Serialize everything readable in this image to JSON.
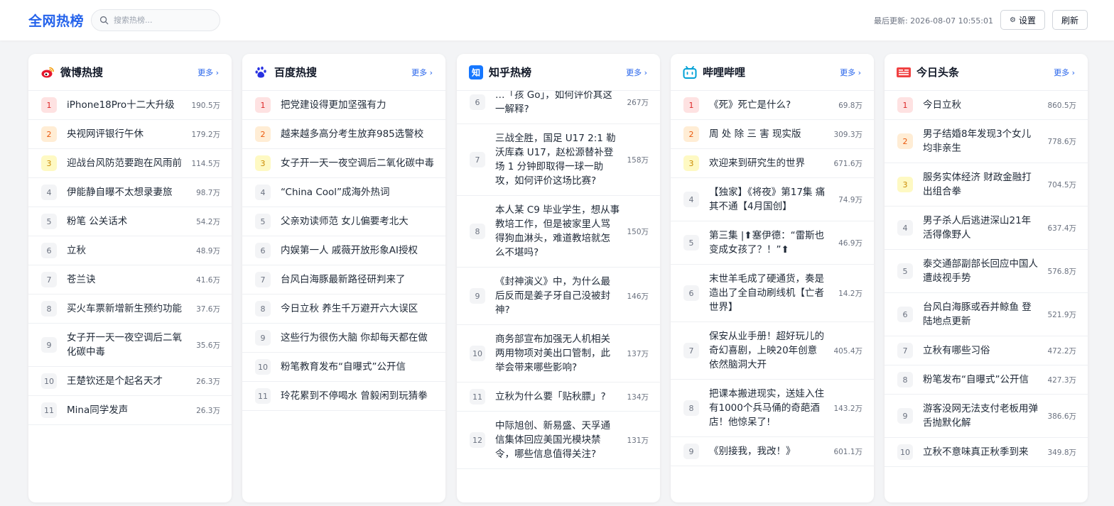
{
  "app": {
    "title": "全网热榜",
    "search_placeholder": "搜索热榜...",
    "updated_label": "最后更新: 2026-08-07 10:55:01",
    "settings_label": "设置",
    "refresh_label": "刷新",
    "accent_color": "#2563eb"
  },
  "boards": [
    {
      "title": "微博热搜",
      "icon": "weibo-icon",
      "more_label": "更多 ›",
      "items": [
        {
          "rank": "1",
          "title": "iPhone18Pro十二大升级",
          "heat": "190.5万"
        },
        {
          "rank": "2",
          "title": "央视网评银行午休",
          "heat": "179.2万"
        },
        {
          "rank": "3",
          "title": "迎战台风防范要跑在风雨前",
          "heat": "114.5万"
        },
        {
          "rank": "4",
          "title": "伊能静自曝不太想录妻旅",
          "heat": "98.7万"
        },
        {
          "rank": "5",
          "title": "粉笔 公关话术",
          "heat": "54.2万"
        },
        {
          "rank": "6",
          "title": "立秋",
          "heat": "48.9万"
        },
        {
          "rank": "7",
          "title": "苍兰诀",
          "heat": "41.6万"
        },
        {
          "rank": "8",
          "title": "买火车票新增新生预约功能",
          "heat": "37.6万"
        },
        {
          "rank": "9",
          "title": "女子开一天一夜空调后二氧化碳中毒",
          "heat": "35.6万"
        },
        {
          "rank": "10",
          "title": "王楚钦还是个起名天才",
          "heat": "26.3万"
        },
        {
          "rank": "11",
          "title": "Mina同学发声",
          "heat": "26.3万"
        }
      ]
    },
    {
      "title": "百度热搜",
      "icon": "baidu-paw-icon",
      "more_label": "更多 ›",
      "items": [
        {
          "rank": "1",
          "title": "把党建设得更加坚强有力",
          "heat": ""
        },
        {
          "rank": "2",
          "title": "越来越多高分考生放弃985选警校",
          "heat": ""
        },
        {
          "rank": "3",
          "title": "女子开一天一夜空调后二氧化碳中毒",
          "heat": ""
        },
        {
          "rank": "4",
          "title": "“China Cool”成海外热词",
          "heat": ""
        },
        {
          "rank": "5",
          "title": "父亲劝读师范 女儿偏要考北大",
          "heat": ""
        },
        {
          "rank": "6",
          "title": "内娱第一人 戚薇开放形象AI授权",
          "heat": ""
        },
        {
          "rank": "7",
          "title": "台风白海豚最新路径研判来了",
          "heat": ""
        },
        {
          "rank": "8",
          "title": "今日立秋 养生千万避开六大误区",
          "heat": ""
        },
        {
          "rank": "9",
          "title": "这些行为很伤大脑 你却每天都在做",
          "heat": ""
        },
        {
          "rank": "10",
          "title": "粉笔教育发布“自曝式”公开信",
          "heat": ""
        },
        {
          "rank": "11",
          "title": "玲花累到不停喝水 曾毅闲到玩猜拳",
          "heat": ""
        }
      ]
    },
    {
      "title": "知乎热榜",
      "icon": "zhihu-icon",
      "more_label": "更多 ›",
      "items": [
        {
          "rank": "6",
          "title": "…「孩 Go」，如何评价其这一解释?",
          "heat": "267万"
        },
        {
          "rank": "7",
          "title": "三战全胜，国足 U17 2:1 勒沃库森 U17，赵松源替补登场 1 分钟即取得一球一助攻，如何评价这场比赛?",
          "heat": "158万"
        },
        {
          "rank": "8",
          "title": "本人某 C9 毕业学生，想从事教培工作，但是被家里人骂得狗血淋头，难道教培就怎么不堪吗?",
          "heat": "150万"
        },
        {
          "rank": "9",
          "title": "《封神演义》中，为什么最后反而是姜子牙自己没被封神?",
          "heat": "146万"
        },
        {
          "rank": "10",
          "title": "商务部宣布加强无人机相关两用物项对美出口管制，此举会带来哪些影响?",
          "heat": "137万"
        },
        {
          "rank": "11",
          "title": "立秋为什么要「贴秋膘」?",
          "heat": "134万"
        },
        {
          "rank": "12",
          "title": "中际旭创、新易盛、天孚通信集体回应美国光模块禁令，哪些信息值得关注?",
          "heat": "131万"
        }
      ]
    },
    {
      "title": "哔哩哔哩",
      "icon": "bilibili-tv-icon",
      "more_label": "更多 ›",
      "items": [
        {
          "rank": "1",
          "title": "《死》死亡是什么?",
          "heat": "69.8万"
        },
        {
          "rank": "2",
          "title": "周 处 除 三 害 现实版",
          "heat": "309.3万"
        },
        {
          "rank": "3",
          "title": "欢迎来到研究生的世界",
          "heat": "671.6万"
        },
        {
          "rank": "4",
          "title": "【独家】《将夜》第17集 痛其不通【4月国创】",
          "heat": "74.9万"
        },
        {
          "rank": "5",
          "title": "第三集 |⬆塞伊德：“雷斯也变成女孩了？！”⬆",
          "heat": "46.9万"
        },
        {
          "rank": "6",
          "title": "末世羊毛成了硬通货，奏是造出了全自动刷线机【亡者世界】",
          "heat": "14.2万"
        },
        {
          "rank": "7",
          "title": "保安从业手册！超好玩儿的奇幻喜剧，上映20年创意依然脑洞大开",
          "heat": "405.4万"
        },
        {
          "rank": "8",
          "title": "把课本搬进现实，送娃入住有1000个兵马俑的奇葩酒店！他惊呆了!",
          "heat": "143.2万"
        },
        {
          "rank": "9",
          "title": "《别接我，我改！》",
          "heat": "601.1万"
        }
      ]
    },
    {
      "title": "今日头条",
      "icon": "toutiao-icon",
      "more_label": "更多 ›",
      "items": [
        {
          "rank": "1",
          "title": "今日立秋",
          "heat": "860.5万"
        },
        {
          "rank": "2",
          "title": "男子结婚8年发现3个女儿均非亲生",
          "heat": "778.6万"
        },
        {
          "rank": "3",
          "title": "服务实体经济 财政金融打出组合拳",
          "heat": "704.5万"
        },
        {
          "rank": "4",
          "title": "男子杀人后逃进深山21年活得像野人",
          "heat": "637.4万"
        },
        {
          "rank": "5",
          "title": "泰交通部副部长回应中国人遭歧视手势",
          "heat": "576.8万"
        },
        {
          "rank": "6",
          "title": "台风白海豚或吞并鲸鱼 登陆地点更新",
          "heat": "521.9万"
        },
        {
          "rank": "7",
          "title": "立秋有哪些习俗",
          "heat": "472.2万"
        },
        {
          "rank": "8",
          "title": "粉笔发布“自曝式”公开信",
          "heat": "427.3万"
        },
        {
          "rank": "9",
          "title": "游客没网无法支付老板用弹舌抛默化解",
          "heat": "386.6万"
        },
        {
          "rank": "10",
          "title": "立秋不意味真正秋季到来",
          "heat": "349.8万"
        }
      ]
    }
  ]
}
